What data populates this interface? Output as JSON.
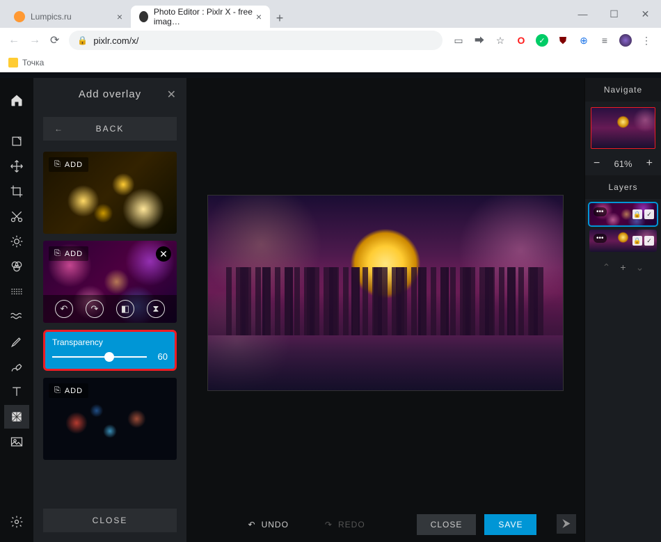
{
  "browser": {
    "tabs": [
      {
        "title": "Lumpics.ru",
        "active": false
      },
      {
        "title": "Photo Editor : Pixlr X - free imag…",
        "active": true
      }
    ],
    "url": "pixlr.com/x/",
    "bookmark": "Точка"
  },
  "panel": {
    "title": "Add overlay",
    "back": "BACK",
    "add_label": "ADD",
    "transparency_label": "Transparency",
    "transparency_value": 60,
    "close": "CLOSE"
  },
  "bottom": {
    "undo": "UNDO",
    "redo": "REDO",
    "close": "CLOSE",
    "save": "SAVE"
  },
  "right": {
    "navigate": "Navigate",
    "zoom": "61%",
    "layers": "Layers"
  }
}
